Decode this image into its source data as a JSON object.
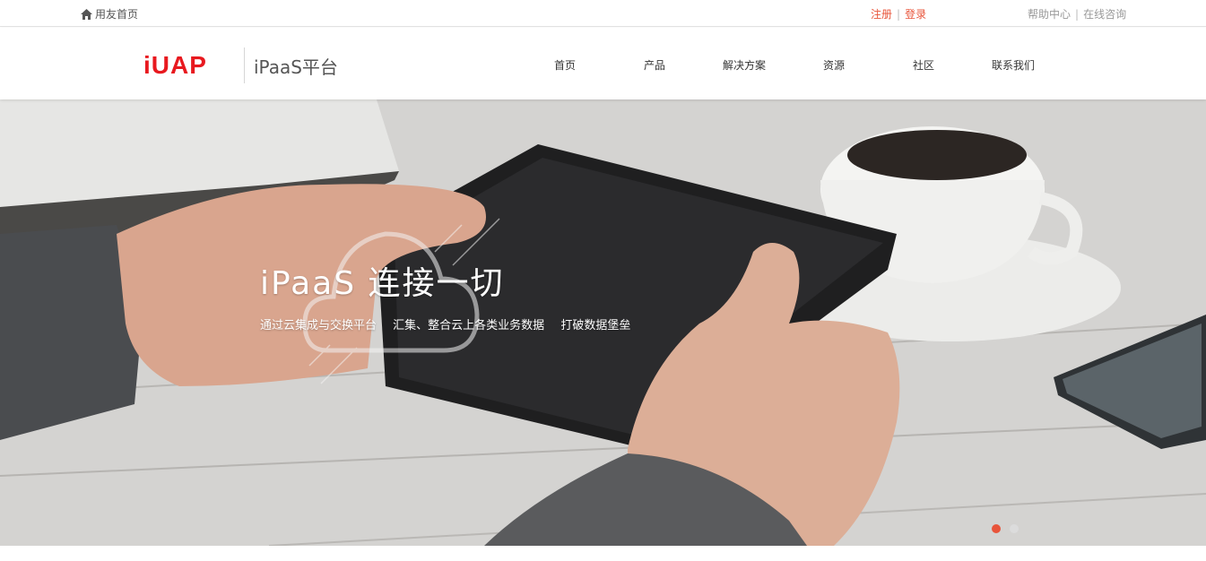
{
  "topbar": {
    "home_label": "用友首页",
    "register_label": "注册",
    "login_label": "登录",
    "separator": "|",
    "help_center_label": "帮助中心",
    "online_consult_label": "在线咨询"
  },
  "header": {
    "logo_text": "iUAP",
    "product_name": "iPaaS平台",
    "nav": [
      {
        "label": "首页"
      },
      {
        "label": "产品"
      },
      {
        "label": "解决方案"
      },
      {
        "label": "资源"
      },
      {
        "label": "社区"
      },
      {
        "label": "联系我们"
      }
    ]
  },
  "hero": {
    "title": "iPaaS 连接一切",
    "subtitle_parts": [
      "通过云集成与交换平台",
      "汇集、整合云上各类业务数据",
      "打破数据堡垒"
    ],
    "slides": {
      "count": 2,
      "active_index": 0
    }
  },
  "colors": {
    "brand_red": "#e8191f",
    "accent_orange": "#e8543a"
  },
  "icons": [
    "home-icon",
    "cloud-icon"
  ]
}
